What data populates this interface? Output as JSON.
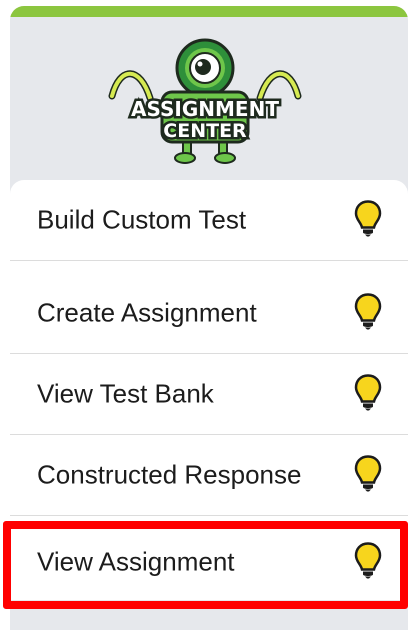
{
  "logo": {
    "line1": "ASSIGNMENT",
    "line2": "CENTER"
  },
  "menu": {
    "items": [
      {
        "label": "Build Custom Test",
        "icon": "lightbulb-icon"
      },
      {
        "label": "Create Assignment",
        "icon": "lightbulb-icon"
      },
      {
        "label": "View Test Bank",
        "icon": "lightbulb-icon"
      },
      {
        "label": "Constructed Response",
        "icon": "lightbulb-icon"
      },
      {
        "label": "View Assignment",
        "icon": "lightbulb-icon",
        "highlighted": true
      }
    ]
  },
  "colors": {
    "accent": "#8cc63f",
    "highlight": "#ff0000",
    "bulb": "#f7d51d",
    "panel": "#e6e8ec"
  }
}
